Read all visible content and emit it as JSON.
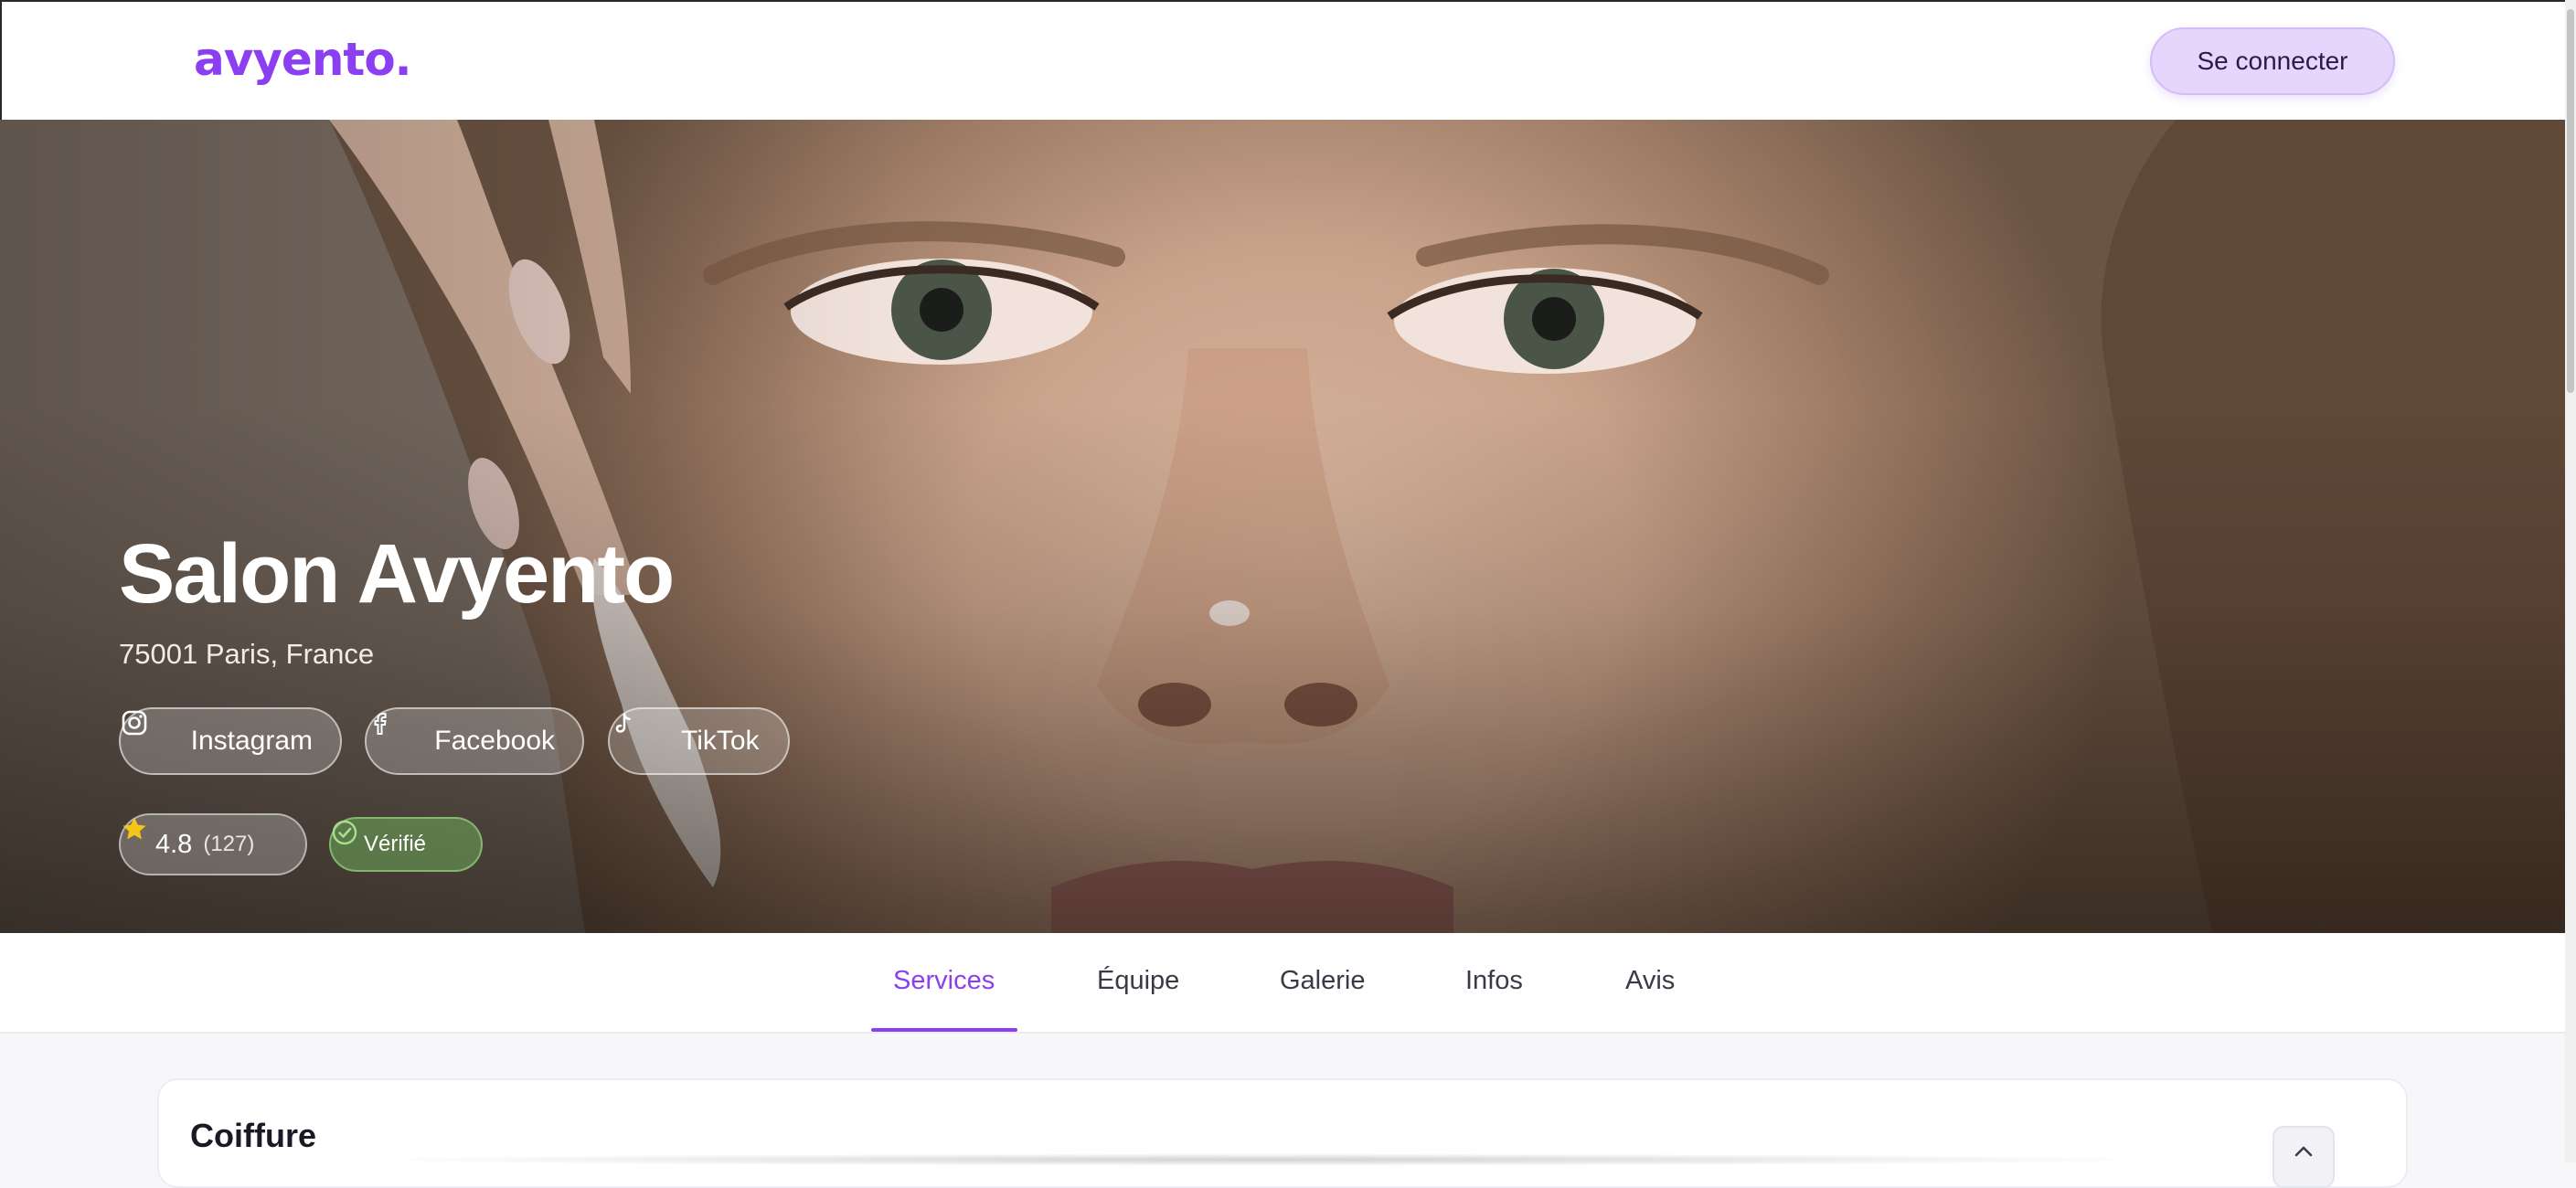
{
  "header": {
    "logo_text": "avyento.",
    "login_label": "Se connecter"
  },
  "hero": {
    "title": "Salon Avyento",
    "address": "75001 Paris, France",
    "social": [
      {
        "label": "Instagram",
        "icon": "instagram-icon"
      },
      {
        "label": "Facebook",
        "icon": "facebook-icon"
      },
      {
        "label": "TikTok",
        "icon": "tiktok-icon"
      }
    ],
    "rating": {
      "value": "4.8",
      "count": "(127)",
      "icon": "star-icon"
    },
    "verified": {
      "label": "Vérifié",
      "icon": "check-circle-icon"
    }
  },
  "tabs": [
    {
      "label": "Services",
      "active": true
    },
    {
      "label": "Équipe",
      "active": false
    },
    {
      "label": "Galerie",
      "active": false
    },
    {
      "label": "Infos",
      "active": false
    },
    {
      "label": "Avis",
      "active": false
    }
  ],
  "sections": [
    {
      "title": "Coiffure",
      "toggle_icon": "chevron-up-icon"
    }
  ],
  "colors": {
    "accent": "#8b3ff0",
    "login_bg": "#e6d6fb",
    "verified": "#6eaa5a",
    "star": "#f5c518"
  }
}
